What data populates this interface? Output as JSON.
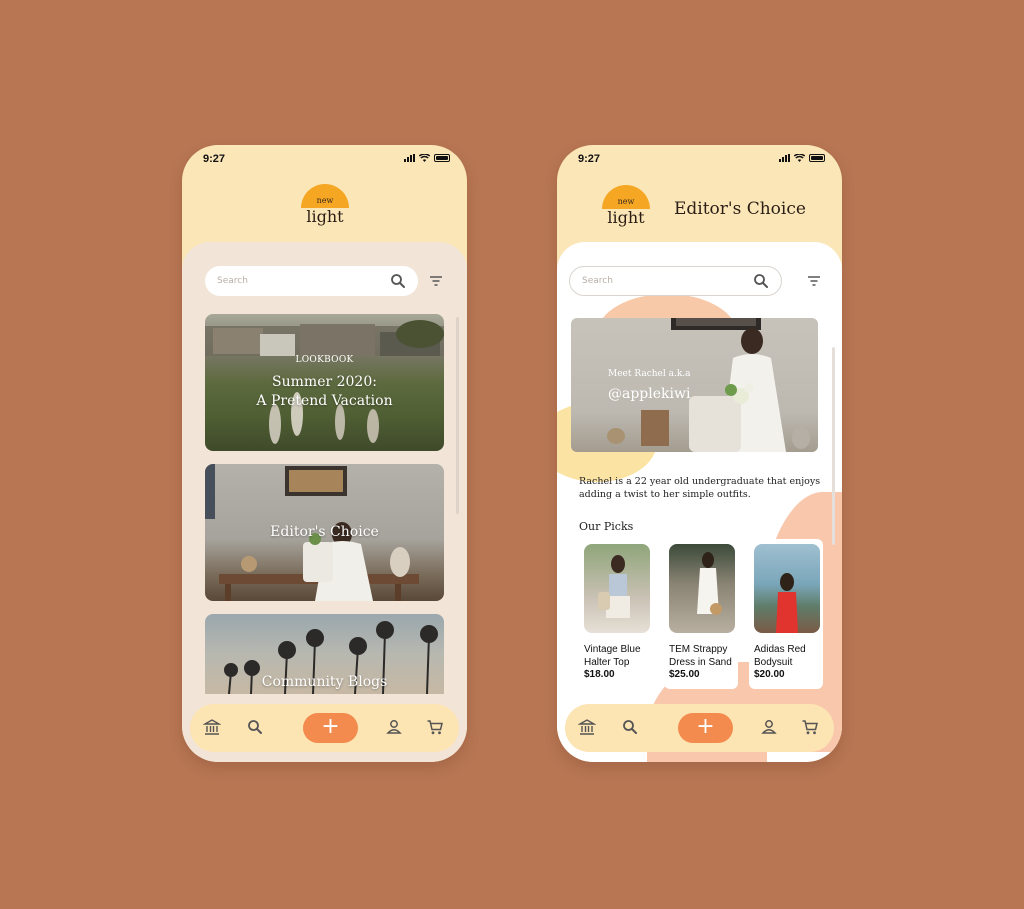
{
  "status": {
    "time": "9:27"
  },
  "logo": {
    "small": "new",
    "main": "light"
  },
  "search": {
    "placeholder": "Search"
  },
  "left_screen": {
    "cards": [
      {
        "kicker": "LOOKBOOK",
        "title_line1": "Summer 2020:",
        "title_line2": "A Pretend Vacation"
      },
      {
        "title": "Editor's Choice"
      },
      {
        "title": "Community Blogs"
      }
    ]
  },
  "right_screen": {
    "title": "Editor's Choice",
    "feature": {
      "subtitle": "Meet Rachel a.k.a",
      "handle": "@applekiwi"
    },
    "bio": "Rachel is a 22 year old undergraduate that enjoys adding a twist to her simple outfits.",
    "picks_heading": "Our Picks",
    "products": [
      {
        "name": "Vintage Blue Halter Top",
        "price": "$18.00"
      },
      {
        "name": "TEM Strappy Dress in Sand",
        "price": "$25.00"
      },
      {
        "name": "Adidas Red Bodysuit",
        "price": "$20.00"
      }
    ]
  },
  "nav": {
    "items": [
      "home-icon",
      "search-icon",
      "add-button",
      "profile-icon",
      "cart-icon"
    ],
    "add_label": "+"
  },
  "colors": {
    "background": "#b87653",
    "header": "#fbe6b8",
    "accent_orange": "#f28b4d",
    "sun": "#f5a623",
    "nav_bar": "#fde4b3"
  }
}
